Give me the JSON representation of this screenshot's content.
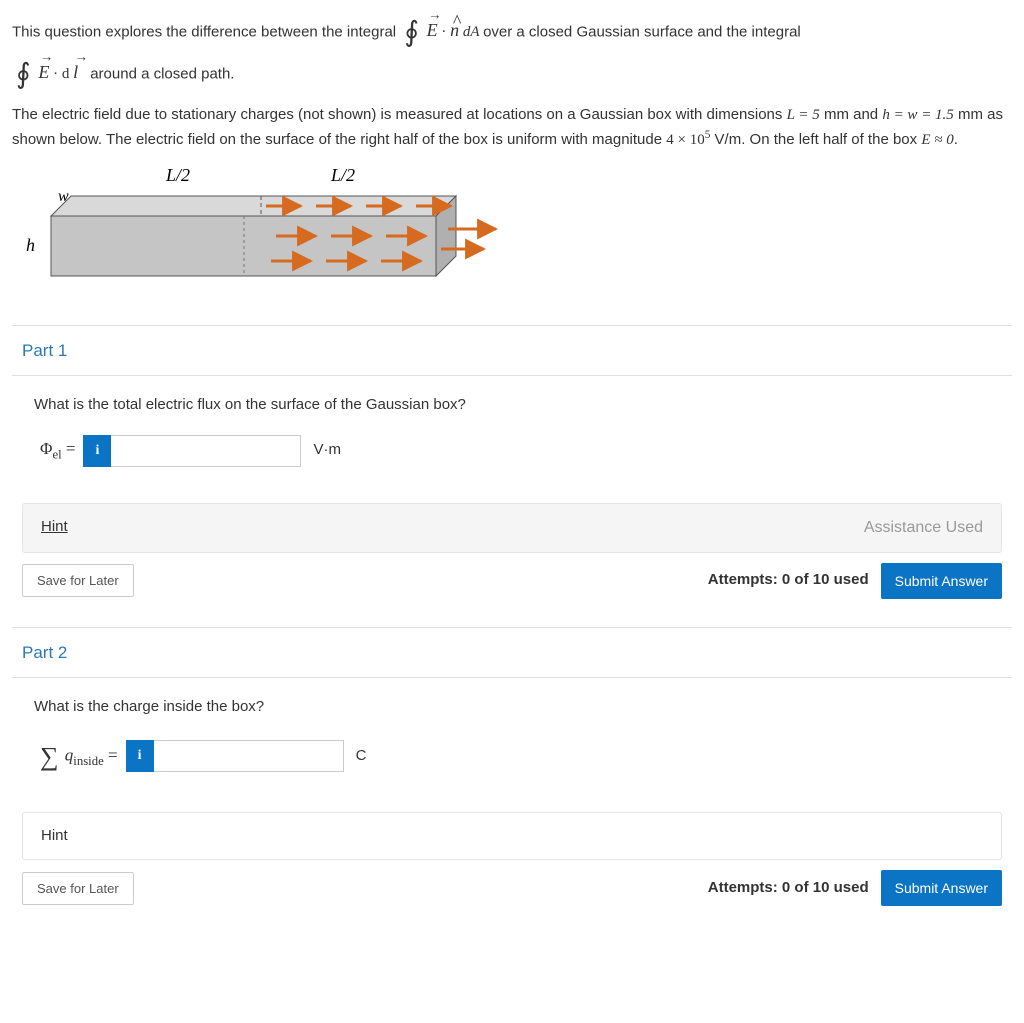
{
  "intro": {
    "line1a": "This question explores the difference between the integral",
    "line1b": "over a closed Gaussian surface and the integral",
    "line2a": "around a closed path.",
    "integral1_expr": "E · n̂ dA",
    "integral2_expr": "E · d l"
  },
  "problem": {
    "text_a": "The electric field due to stationary charges (not shown) is measured at locations on a Gaussian box with dimensions ",
    "L_eq": "L = 5",
    "text_b": " mm and ",
    "hw_eq": "h = w = 1.5",
    "text_c": " mm as shown below. The electric field on the surface of the right half of the box is uniform with magnitude ",
    "E_mag": "4 × 10",
    "E_exp": "5",
    "text_d": " V/m. On the left half of the box ",
    "E_zero": "E ≈ 0",
    "text_e": "."
  },
  "diagram": {
    "labels": {
      "h": "h",
      "w": "w",
      "L_half_left": "L/2",
      "L_half_right": "L/2"
    }
  },
  "part1": {
    "title": "Part 1",
    "question": "What is the total electric flux on the surface of the Gaussian box?",
    "symbol_html": "Φ",
    "symbol_sub": "el",
    "equals": " = ",
    "tooltip_icon": "i",
    "input_value": "",
    "unit": "V·m",
    "hint_label": "Hint",
    "assistance_label": "Assistance Used",
    "save_label": "Save for Later",
    "attempts_label": "Attempts: 0 of 10 used",
    "submit_label": "Submit Answer"
  },
  "part2": {
    "title": "Part 2",
    "question": "What is the charge inside the box?",
    "symbol_sigma": "∑",
    "symbol_q": "q",
    "symbol_sub": "inside",
    "equals": " = ",
    "tooltip_icon": "i",
    "input_value": "",
    "unit": "C",
    "hint_label": "Hint",
    "save_label": "Save for Later",
    "attempts_label": "Attempts: 0 of 10 used",
    "submit_label": "Submit Answer"
  }
}
